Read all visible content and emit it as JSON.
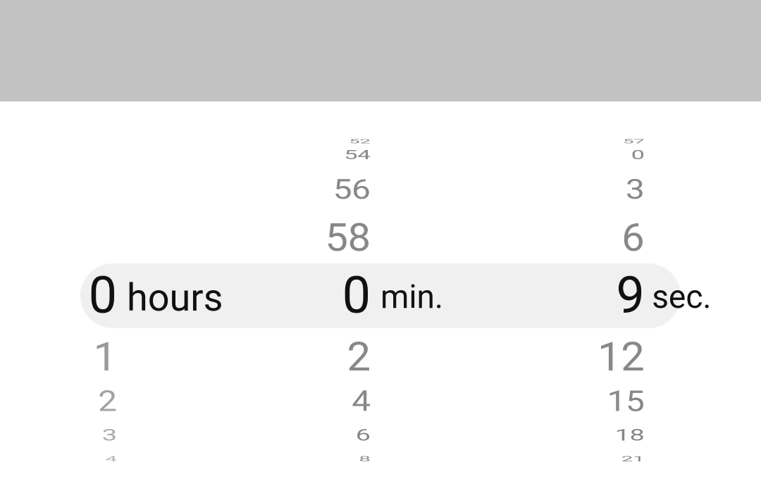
{
  "picker": {
    "hours": {
      "unit_label": "hours",
      "selected": "0",
      "below": [
        "1",
        "2",
        "3",
        "4"
      ]
    },
    "minutes": {
      "unit_label": "min.",
      "selected": "0",
      "above": [
        "52",
        "54",
        "56",
        "58"
      ],
      "below": [
        "2",
        "4",
        "6",
        "8"
      ]
    },
    "seconds": {
      "unit_label": "sec.",
      "selected": "9",
      "above": [
        "57",
        "0",
        "3",
        "6"
      ],
      "below": [
        "12",
        "15",
        "18",
        "21"
      ]
    }
  }
}
